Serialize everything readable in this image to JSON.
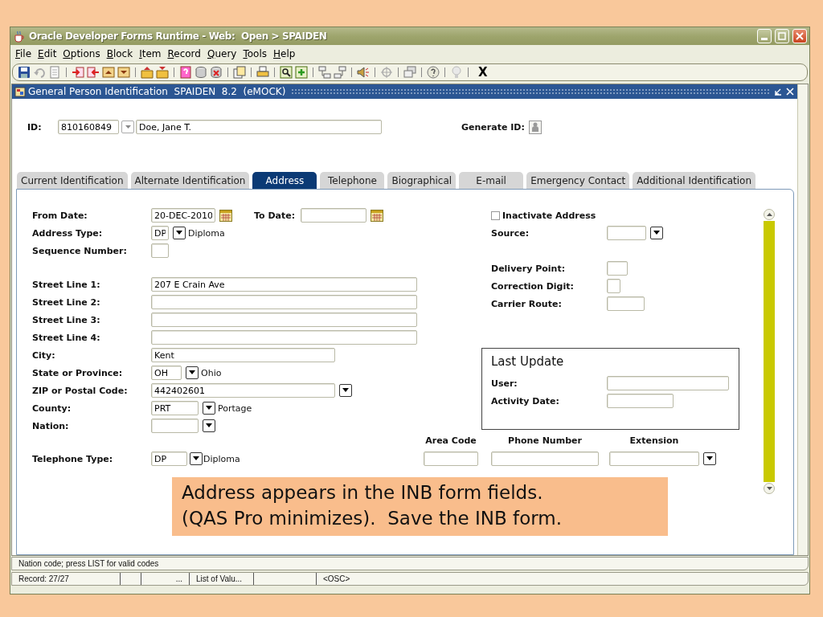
{
  "window": {
    "title": "Oracle Developer Forms Runtime - Web:  Open > SPAIDEN"
  },
  "menu": [
    "File",
    "Edit",
    "Options",
    "Block",
    "Item",
    "Record",
    "Query",
    "Tools",
    "Help"
  ],
  "toolbar": {
    "exit_label": "X"
  },
  "form_window": {
    "title": "General Person Identification  SPAIDEN  8.2  (eMOCK)"
  },
  "key_block": {
    "id_label": "ID:",
    "id_value": "810160849",
    "name_value": "Doe, Jane T.",
    "generate_label": "Generate ID:"
  },
  "tabs": [
    {
      "label": "Current Identification",
      "selected": false
    },
    {
      "label": "Alternate Identification",
      "selected": false
    },
    {
      "label": "Address",
      "selected": true
    },
    {
      "label": "Telephone",
      "selected": false
    },
    {
      "label": "Biographical",
      "selected": false
    },
    {
      "label": "E-mail",
      "selected": false
    },
    {
      "label": "Emergency Contact",
      "selected": false
    },
    {
      "label": "Additional Identification",
      "selected": false
    }
  ],
  "address_fields": [
    {
      "kind": "date_range",
      "label": "From Date:",
      "value": "20-DEC-2010",
      "to_label": "To Date:"
    },
    {
      "kind": "lookup",
      "label": "Address Type:",
      "code": "DP",
      "description": "Diploma"
    },
    {
      "kind": "small",
      "label": "Sequence Number:"
    },
    {
      "kind": "long",
      "label": "Street Line 1:",
      "value": "207 E Crain Ave"
    },
    {
      "kind": "long",
      "label": "Street Line 2:"
    },
    {
      "kind": "long",
      "label": "Street Line 3:"
    },
    {
      "kind": "long",
      "label": "Street Line 4:"
    },
    {
      "kind": "medium",
      "label": "City:",
      "value": "Kent"
    },
    {
      "kind": "lookup",
      "label": "State or Province:",
      "code": "OH",
      "description": "Ohio"
    },
    {
      "kind": "medium_list",
      "label": "ZIP or Postal Code:",
      "value": "442402601"
    },
    {
      "kind": "lookup",
      "label": "County:",
      "code": "PRT",
      "description": "Portage"
    },
    {
      "kind": "lookup",
      "label": "Nation:"
    }
  ],
  "address_details": [
    {
      "kind": "checkbox",
      "label": "Inactivate Address",
      "checked": false
    },
    {
      "kind": "list",
      "label": "Source:"
    },
    {
      "kind": "tiny",
      "label": "Delivery Point:"
    },
    {
      "kind": "mini",
      "label": "Correction Digit:"
    },
    {
      "kind": "short",
      "label": "Carrier Route:"
    }
  ],
  "last_update": {
    "title": "Last Update",
    "fields": [
      {
        "kind": "long",
        "label": "User:"
      },
      {
        "kind": "short",
        "label": "Activity Date:"
      }
    ]
  },
  "telephone": {
    "label": "Telephone Type:",
    "code": "DP",
    "description": "Diploma",
    "columns": [
      "Area Code",
      "Phone Number",
      "Extension"
    ]
  },
  "callout": {
    "lines": [
      "Address appears in the INB form fields.",
      "(QAS Pro minimizes).  Save the INB form."
    ]
  },
  "status": {
    "message": "Nation code; press LIST for valid codes",
    "cells": [
      "Record: 27/27",
      "...",
      "List of Valu...",
      "<OSC>"
    ]
  }
}
